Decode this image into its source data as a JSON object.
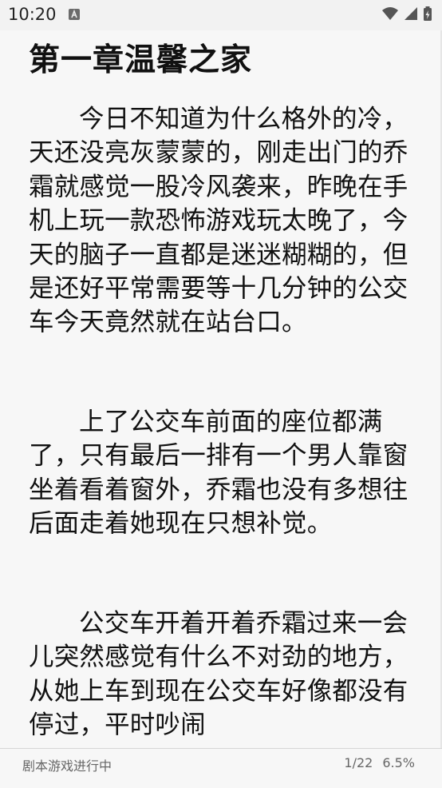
{
  "status_bar": {
    "time": "10:20",
    "icons": [
      "notification-a-icon",
      "wifi-icon",
      "cell-signal-icon",
      "battery-charging-icon"
    ]
  },
  "reader": {
    "chapter_title": "第一章温馨之家",
    "paragraphs": [
      "今日不知道为什么格外的冷，天还没亮灰蒙蒙的，刚走出门的乔霜就感觉一股冷风袭来，昨晚在手机上玩一款恐怖游戏玩太晚了，今天的脑子一直都是迷迷糊糊的，但是还好平常需要等十几分钟的公交车今天竟然就在站台口。",
      "上了公交车前面的座位都满了，只有最后一排有一个男人靠窗坐着看着窗外，乔霜也没有多想往后面走着她现在只想补觉。",
      "公交车开着开着乔霜过来一会儿突然感觉有什么不对劲的地方，从她上车到现在公交车好像都没有停过，平时吵闹"
    ]
  },
  "footer": {
    "book_title": "剧本游戏进行中",
    "page": "1/22",
    "progress": "6.5%"
  }
}
